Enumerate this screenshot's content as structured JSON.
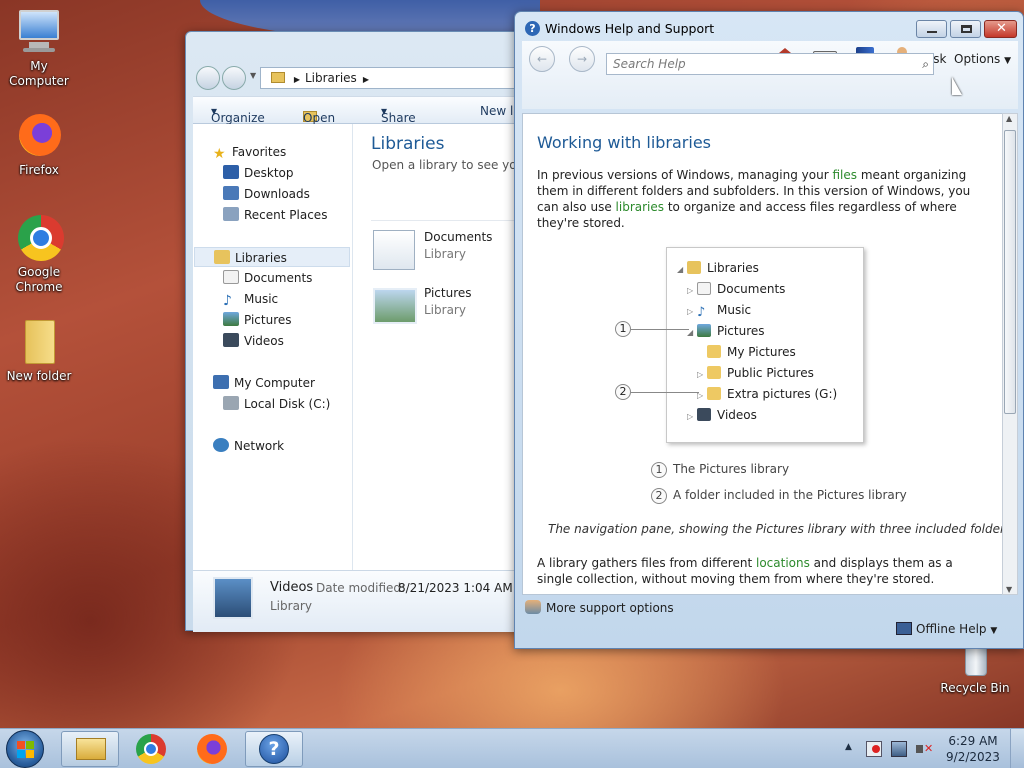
{
  "desktop": {
    "icons": [
      {
        "label": "My Computer",
        "icon": "computer-icon"
      },
      {
        "label": "Firefox",
        "icon": "firefox-icon"
      },
      {
        "label": "Google Chrome",
        "icon": "chrome-icon"
      },
      {
        "label": "New folder",
        "icon": "folder-icon"
      },
      {
        "label": "Recycle Bin",
        "icon": "recycle-bin-icon"
      }
    ]
  },
  "explorer": {
    "breadcrumb": "Libraries",
    "toolbar": {
      "organize": "Organize",
      "open": "Open",
      "share_with": "Share with",
      "new_library": "New li"
    },
    "nav": {
      "favorites": "Favorites",
      "desktop": "Desktop",
      "downloads": "Downloads",
      "recent_places": "Recent Places",
      "libraries": "Libraries",
      "documents": "Documents",
      "music": "Music",
      "pictures": "Pictures",
      "videos": "Videos",
      "my_computer": "My Computer",
      "local_disk": "Local Disk (C:)",
      "network": "Network"
    },
    "content": {
      "heading": "Libraries",
      "subheading": "Open a library to see your f",
      "items": [
        {
          "name": "Documents",
          "type": "Library"
        },
        {
          "name": "Pictures",
          "type": "Library"
        }
      ]
    },
    "details": {
      "name": "Videos",
      "date_label": "Date modified:",
      "date_value": "8/21/2023 1:04 AM",
      "type": "Library"
    }
  },
  "help": {
    "title": "Windows Help and Support",
    "toolbar": {
      "ask": "Ask",
      "options": "Options"
    },
    "search_placeholder": "Search Help",
    "heading": "Working with libraries",
    "para1_a": "In previous versions of Windows, managing your ",
    "para1_link1": "files",
    "para1_b": " meant organizing them in different folders and subfolders. In this version of Windows, you can also use ",
    "para1_link2": "libraries",
    "para1_c": " to organize and access files regardless of where they're stored.",
    "tree": {
      "libraries": "Libraries",
      "documents": "Documents",
      "music": "Music",
      "pictures": "Pictures",
      "my_pictures": "My Pictures",
      "public_pictures": "Public Pictures",
      "extra_pictures": "Extra pictures (G:)",
      "videos": "Videos"
    },
    "callouts": [
      "1",
      "2"
    ],
    "legend": [
      {
        "num": "1",
        "text": "The Pictures library"
      },
      {
        "num": "2",
        "text": "A folder included in the Pictures library"
      }
    ],
    "caption": "The navigation pane, showing the Pictures library with three included folders",
    "para2_a": "A library gathers files from different ",
    "para2_link": "locations",
    "para2_b": " and displays them as a single collection, without moving them from where they're stored.",
    "more_support": "More support options",
    "offline_help": "Offline Help"
  },
  "taskbar": {
    "apps": [
      "windows-explorer-icon",
      "chrome-icon",
      "firefox-icon",
      "help-icon"
    ],
    "time": "6:29 AM",
    "date": "9/2/2023"
  },
  "colors": {
    "link": "#2c8a2c",
    "heading": "#1e5a96",
    "accent": "#3a6ea5"
  }
}
